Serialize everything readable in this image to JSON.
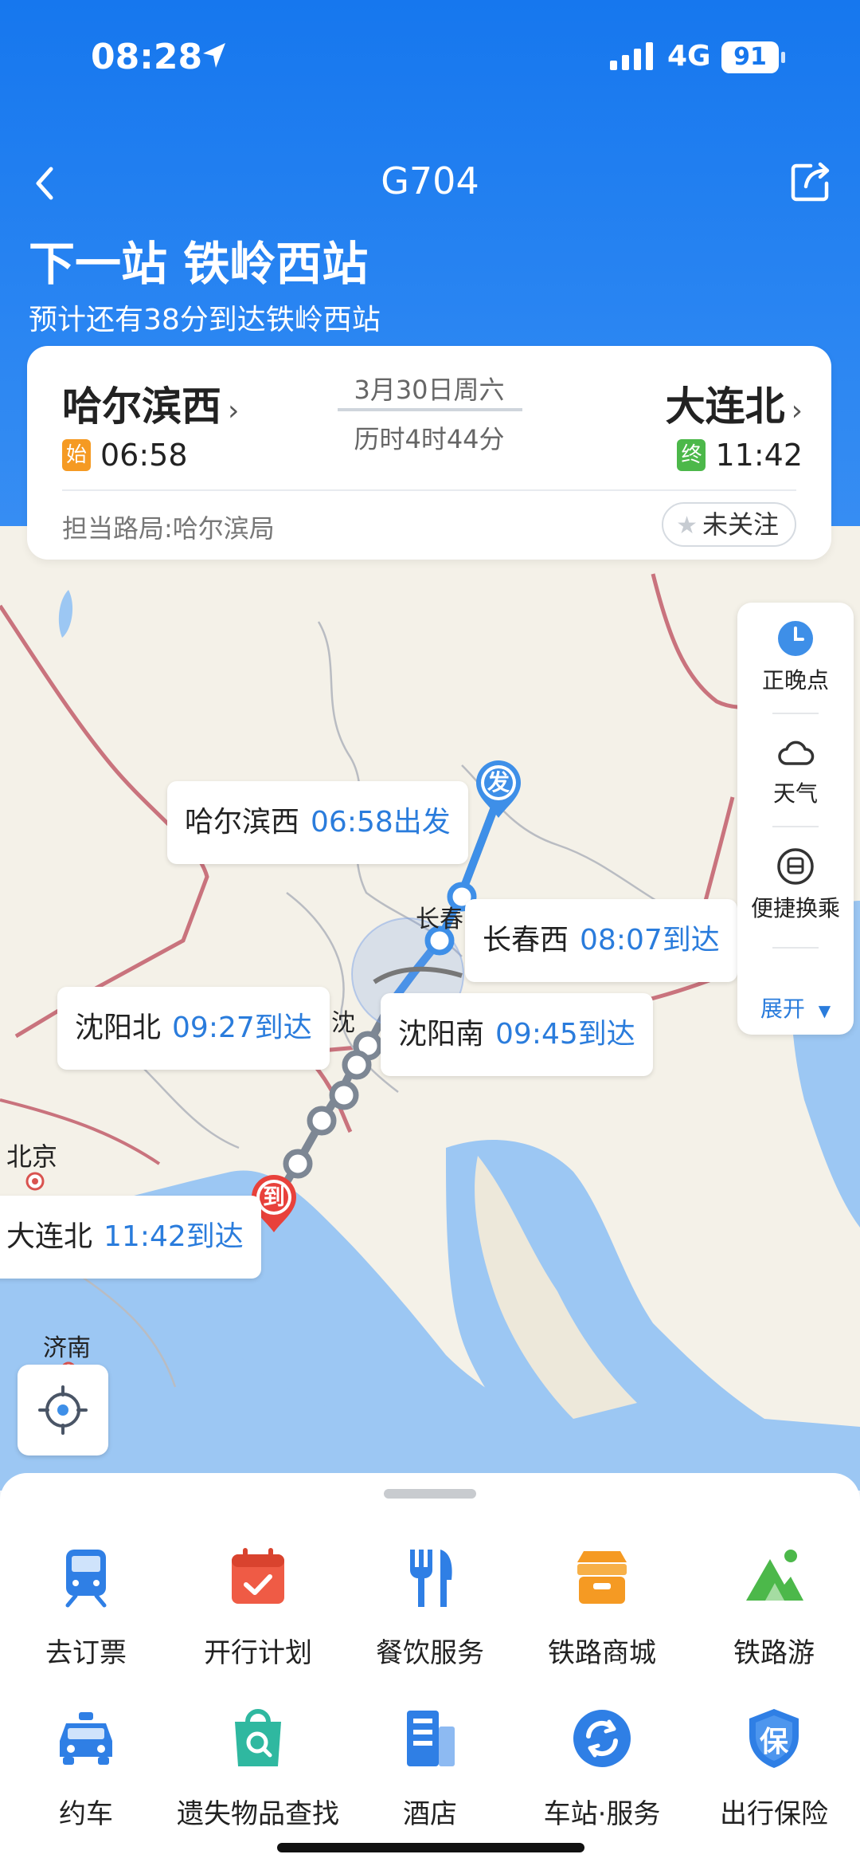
{
  "status_bar": {
    "time": "08:28",
    "network": "4G",
    "battery": "91"
  },
  "nav": {
    "title": "G704"
  },
  "next_station": {
    "headline": "下一站 铁岭西站",
    "eta": "预计还有38分到达铁岭西站"
  },
  "route": {
    "from": {
      "name": "哈尔滨西",
      "tag": "始",
      "time": "06:58"
    },
    "to": {
      "name": "大连北",
      "tag": "终",
      "time": "11:42"
    },
    "date": "3月30日周六",
    "duration": "历时4时44分",
    "bureau": "担当路局:哈尔滨局",
    "follow_label": "未关注"
  },
  "map": {
    "callouts": [
      {
        "station": "哈尔滨西",
        "time": "06:58出发"
      },
      {
        "station": "长春西",
        "time": "08:07到达"
      },
      {
        "station": "沈阳北",
        "time": "09:27到达"
      },
      {
        "station": "沈阳南",
        "time": "09:45到达"
      },
      {
        "station": "大连北",
        "time": "11:42到达"
      }
    ],
    "pins": {
      "depart": "发",
      "arrive": "到"
    },
    "place_labels": [
      "北京",
      "济南",
      "长春",
      "沈"
    ],
    "side_panel": {
      "items": [
        "正晚点",
        "天气",
        "便捷换乘"
      ],
      "expand": "展开"
    }
  },
  "services": {
    "row1": [
      "去订票",
      "开行计划",
      "餐饮服务",
      "铁路商城",
      "铁路游"
    ],
    "row2": [
      "约车",
      "遗失物品查找",
      "酒店",
      "车站·服务",
      "出行保险"
    ]
  },
  "colors": {
    "primary": "#1677ee",
    "accent_blue": "#2a7cdc",
    "arrive_red": "#e8413b",
    "start_orange": "#f59a23",
    "end_green": "#4cb84a"
  }
}
